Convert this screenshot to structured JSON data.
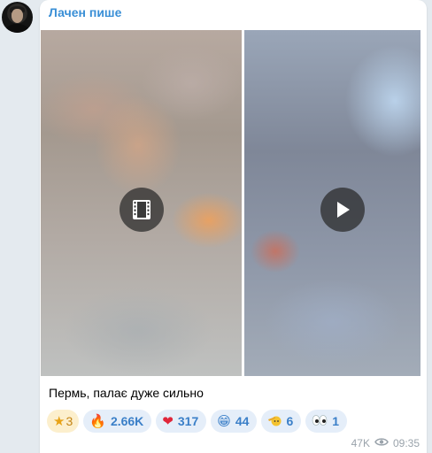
{
  "author": "Лачен пише",
  "media": [
    {
      "type": "video-album",
      "icon": "film-icon"
    },
    {
      "type": "video",
      "icon": "play-icon"
    }
  ],
  "caption": "Пермь, палає дуже сильно",
  "reactions": [
    {
      "emoji": "⭐",
      "icon": "star-icon",
      "count": "3"
    },
    {
      "emoji": "🔥",
      "icon": "fire-icon",
      "count": "2.66K"
    },
    {
      "emoji": "❤️",
      "icon": "heart-icon",
      "count": "317"
    },
    {
      "emoji": "😁",
      "icon": "grin-icon",
      "count": "44"
    },
    {
      "emoji": "🫡",
      "icon": "salute-icon",
      "count": "6"
    },
    {
      "emoji": "👀",
      "icon": "eyes-icon",
      "count": "1"
    }
  ],
  "views": "47K",
  "time": "09:35",
  "colors": {
    "accent": "#3a8fd6",
    "background": "#e4eaef",
    "bubble": "#ffffff",
    "star_chip": "#fcefcd",
    "chip": "#e5eef9"
  }
}
